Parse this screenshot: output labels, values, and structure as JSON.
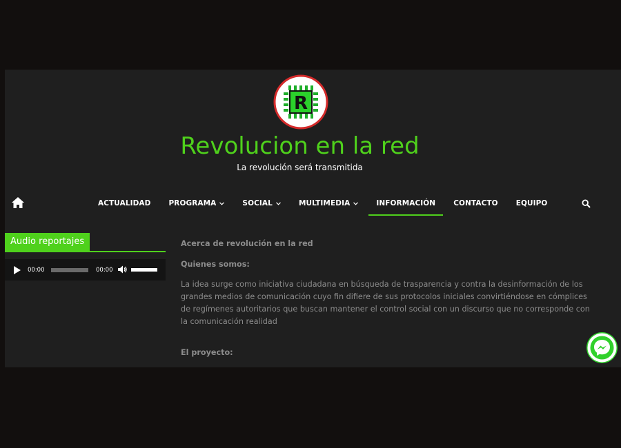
{
  "site": {
    "title": "Revolucion en la red",
    "tagline": "La revolución será transmitida",
    "logo_letter": "R",
    "accent_color": "#4fd11c"
  },
  "nav": {
    "home_icon": "home-icon",
    "items": [
      {
        "label": "ACTUALIDAD",
        "has_dropdown": false,
        "active": false
      },
      {
        "label": "PROGRAMA",
        "has_dropdown": true,
        "active": false
      },
      {
        "label": "SOCIAL",
        "has_dropdown": true,
        "active": false
      },
      {
        "label": "MULTIMEDIA",
        "has_dropdown": true,
        "active": false
      },
      {
        "label": "INFORMACIÓN",
        "has_dropdown": false,
        "active": true
      },
      {
        "label": "CONTACTO",
        "has_dropdown": false,
        "active": false
      },
      {
        "label": "EQUIPO",
        "has_dropdown": false,
        "active": false
      }
    ],
    "search_icon": "search-icon"
  },
  "sidebar": {
    "widget_title": "Audio reportajes",
    "player": {
      "current_time": "00:00",
      "duration": "00:00",
      "progress": 0,
      "volume": 1.0
    }
  },
  "content": {
    "heading": "Acerca de revolución en la red",
    "who_label": "Quienes somos:",
    "who_text": "La idea surge como iniciativa ciudadana en búsqueda de trasparencia y contra la desinformación de los grandes medios de comunicación cuyo fin difiere de sus protocolos iniciales convirtiéndose en cómplices de regímenes autoritarios que buscan mantener el control social con un discurso que no corresponde con la comunicación realidad",
    "project_label": "El proyecto:"
  },
  "floating": {
    "messenger_icon": "messenger-icon"
  }
}
